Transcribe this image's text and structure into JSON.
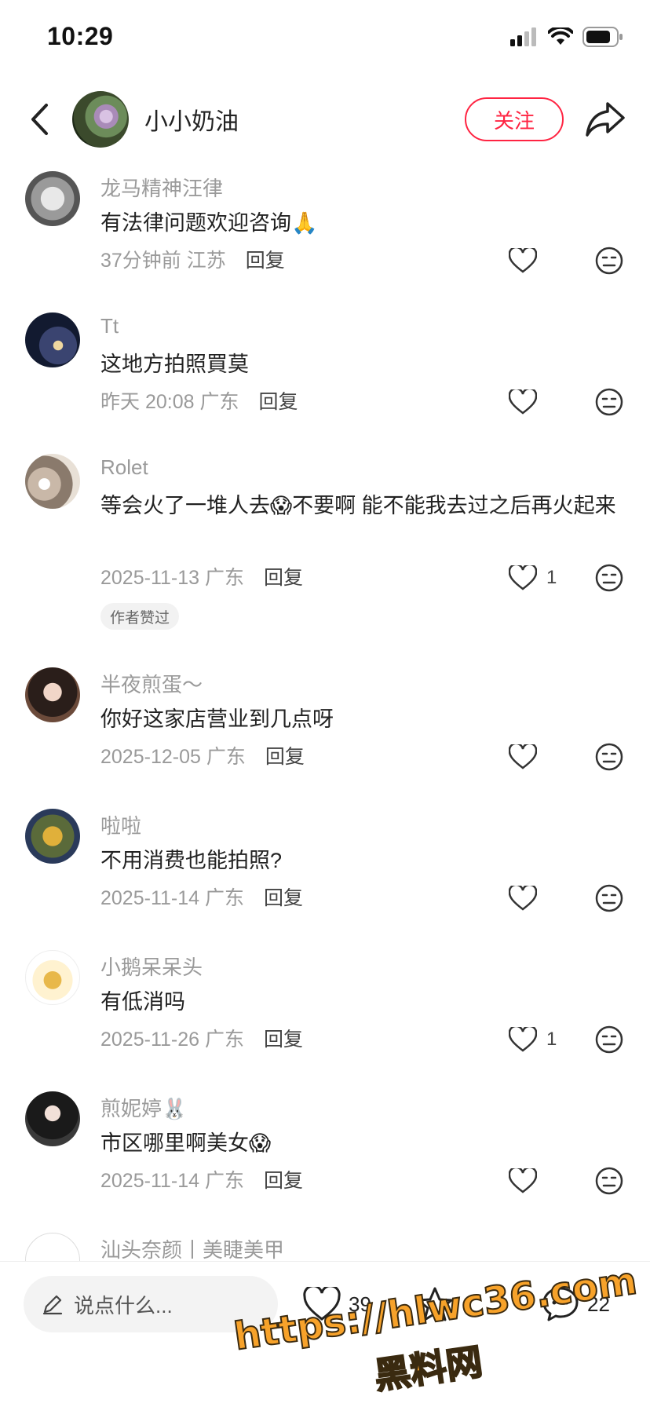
{
  "status_bar": {
    "time": "10:29"
  },
  "header": {
    "author_name": "小小奶油",
    "follow_label": "关注"
  },
  "comments": [
    {
      "user": "龙马精神汪律",
      "text": "有法律问题欢迎咨询🙏",
      "time": "37分钟前",
      "location": "江苏",
      "reply": "回复",
      "likes": ""
    },
    {
      "user": "Tt",
      "text": "这地方拍照買莫",
      "time": "昨天 20:08",
      "location": "广东",
      "reply": "回复",
      "likes": ""
    },
    {
      "user": "Rolet",
      "text": "等会火了一堆人去😱不要啊 能不能我去过之后再火起来",
      "time": "2025-11-13",
      "location": "广东",
      "reply": "回复",
      "likes": "1",
      "badge": "作者赞过"
    },
    {
      "user": "半夜煎蛋～",
      "text": "你好这家店营业到几点呀",
      "time": "2025-12-05",
      "location": "广东",
      "reply": "回复",
      "likes": ""
    },
    {
      "user": "啦啦",
      "text": "不用消费也能拍照?",
      "time": "2025-11-14",
      "location": "广东",
      "reply": "回复",
      "likes": ""
    },
    {
      "user": "小鹅呆呆头",
      "text": "有低消吗",
      "time": "2025-11-26",
      "location": "广东",
      "reply": "回复",
      "likes": "1"
    },
    {
      "user": "煎妮婷🐰",
      "text": "市区哪里啊美女😱",
      "time": "2025-11-14",
      "location": "广东",
      "reply": "回复",
      "likes": ""
    },
    {
      "user": "汕头奈颜丨美睫美甲",
      "text": "",
      "time": "",
      "location": "",
      "reply": "",
      "likes": ""
    }
  ],
  "bottom_bar": {
    "input_placeholder": "说点什么...",
    "like_count": "39",
    "collect_count": "",
    "comment_count": "22"
  },
  "watermark": {
    "line1": "https://hlwc36.com",
    "line2": "黑料网"
  },
  "colors": {
    "accent": "#ff2442",
    "meta_gray": "#9a9a9a",
    "watermark": "#f7a22a"
  },
  "icons": [
    "back-arrow-icon",
    "share-icon",
    "heart-icon",
    "dislike-face-icon",
    "pencil-icon",
    "star-icon",
    "comment-bubble-icon"
  ]
}
